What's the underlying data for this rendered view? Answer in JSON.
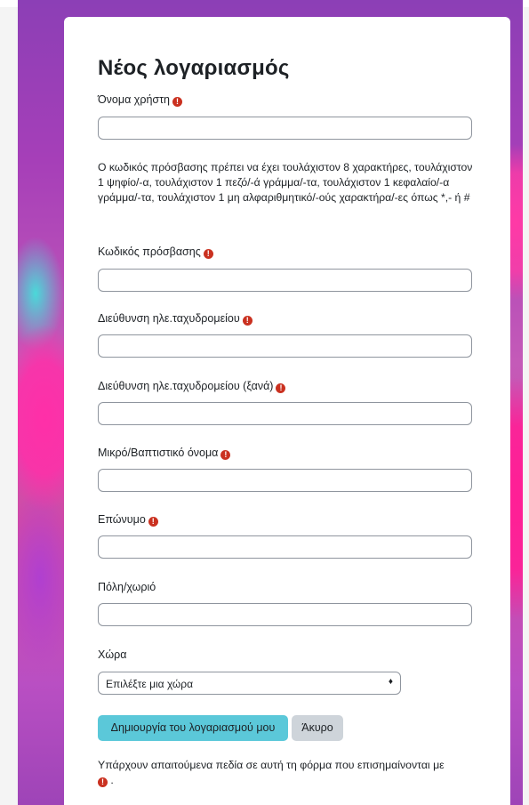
{
  "form": {
    "title": "Νέος λογαριασμός",
    "required_icon": "!",
    "fields": {
      "username": {
        "label": "Όνομα χρήστη",
        "value": ""
      },
      "password": {
        "label": "Κωδικός πρόσβασης",
        "value": ""
      },
      "email": {
        "label": "Διεύθυνση ηλε.ταχυδρομείου",
        "value": ""
      },
      "email_again": {
        "label": "Διεύθυνση ηλε.ταχυδρομείου (ξανά)",
        "value": ""
      },
      "firstname": {
        "label": "Μικρό/Βαπτιστικό όνομα",
        "value": ""
      },
      "lastname": {
        "label": "Επώνυμο",
        "value": ""
      },
      "city": {
        "label": "Πόλη/χωριό",
        "value": ""
      },
      "country": {
        "label": "Χώρα",
        "selected": "Επιλέξτε μια χώρα"
      }
    },
    "password_policy": "Ο κωδικός πρόσβασης πρέπει να έχει τουλάχιστον 8 χαρακτήρες, τουλάχιστον 1 ψηφίο/-α, τουλάχιστον 1 πεζό/-ά γράμμα/-τα, τουλάχιστον 1 κεφαλαίο/-α γράμμα/-τα, τουλάχιστον 1 μη αλφαριθμητικό/-ούς χαρακτήρα/-ες όπως *,- ή #",
    "buttons": {
      "create": "Δημιουργία του λογαριασμού μου",
      "cancel": "Άκυρο"
    },
    "required_note_prefix": "Υπάρχουν απαιτούμενα πεδία σε αυτή τη φόρμα που επισημαίνονται με",
    "required_note_suffix": " ."
  },
  "colors": {
    "primary_button": "#5bc8d9",
    "secondary_button": "#ced4da",
    "required_icon": "#ca3120"
  }
}
